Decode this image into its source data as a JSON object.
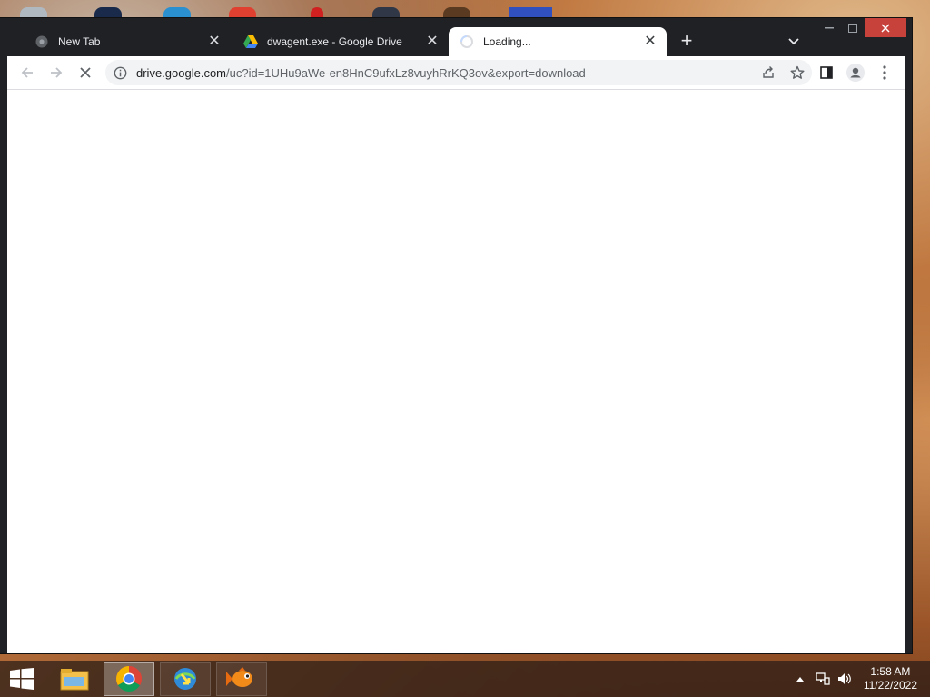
{
  "browser": {
    "tabs": [
      {
        "title": "New Tab",
        "state": "inactive"
      },
      {
        "title": "dwagent.exe - Google Drive",
        "state": "inactive"
      },
      {
        "title": "Loading...",
        "state": "active"
      }
    ],
    "new_tab_label": "+",
    "close_glyph": "✕",
    "address": {
      "host": "drive.google.com",
      "path": "/uc?id=1UHu9aWe-en8HnC9ufxLz8vuyhRrKQ3ov&export=download"
    }
  },
  "taskbar": {
    "apps": [
      {
        "name": "file-explorer"
      },
      {
        "name": "google-chrome"
      },
      {
        "name": "internet-download-manager"
      },
      {
        "name": "goldfish-app"
      }
    ],
    "time": "1:58 AM",
    "date": "11/22/2022"
  },
  "colors": {
    "tabstrip": "#202124",
    "active_tab": "#ffffff",
    "omnibox": "#f1f3f4",
    "close_button": "#c7423b",
    "taskbar": "#281c16"
  }
}
